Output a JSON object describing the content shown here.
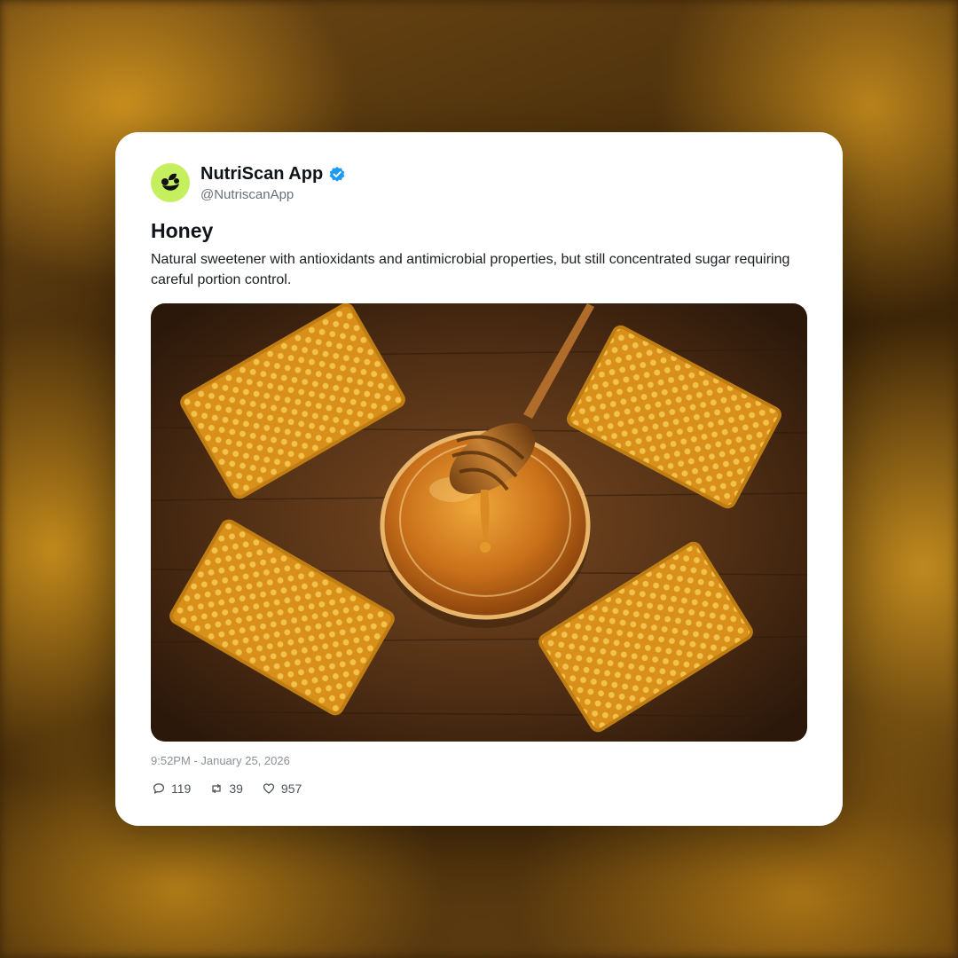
{
  "post": {
    "author_name": "NutriScan App",
    "author_handle": "@NutriscanApp",
    "title": "Honey",
    "body": "Natural sweetener with antioxidants and antimicrobial properties, but still concentrated sugar requiring careful portion control.",
    "timestamp": "9:52PM - January 25, 2026",
    "image_alt": "Honeycomb pieces around a jar of honey with a wooden dipper",
    "stats": {
      "replies": "119",
      "reposts": "39",
      "likes": "957"
    },
    "icons": {
      "avatar": "leaf-logo-icon",
      "verified": "verified-badge-icon",
      "reply": "comment-icon",
      "repost": "repost-icon",
      "like": "heart-icon"
    }
  },
  "colors": {
    "avatar_bg": "#c6ef5f",
    "verified_blue": "#1d9bf0",
    "honey": "#e8a93a",
    "wood": "#5a3517"
  }
}
